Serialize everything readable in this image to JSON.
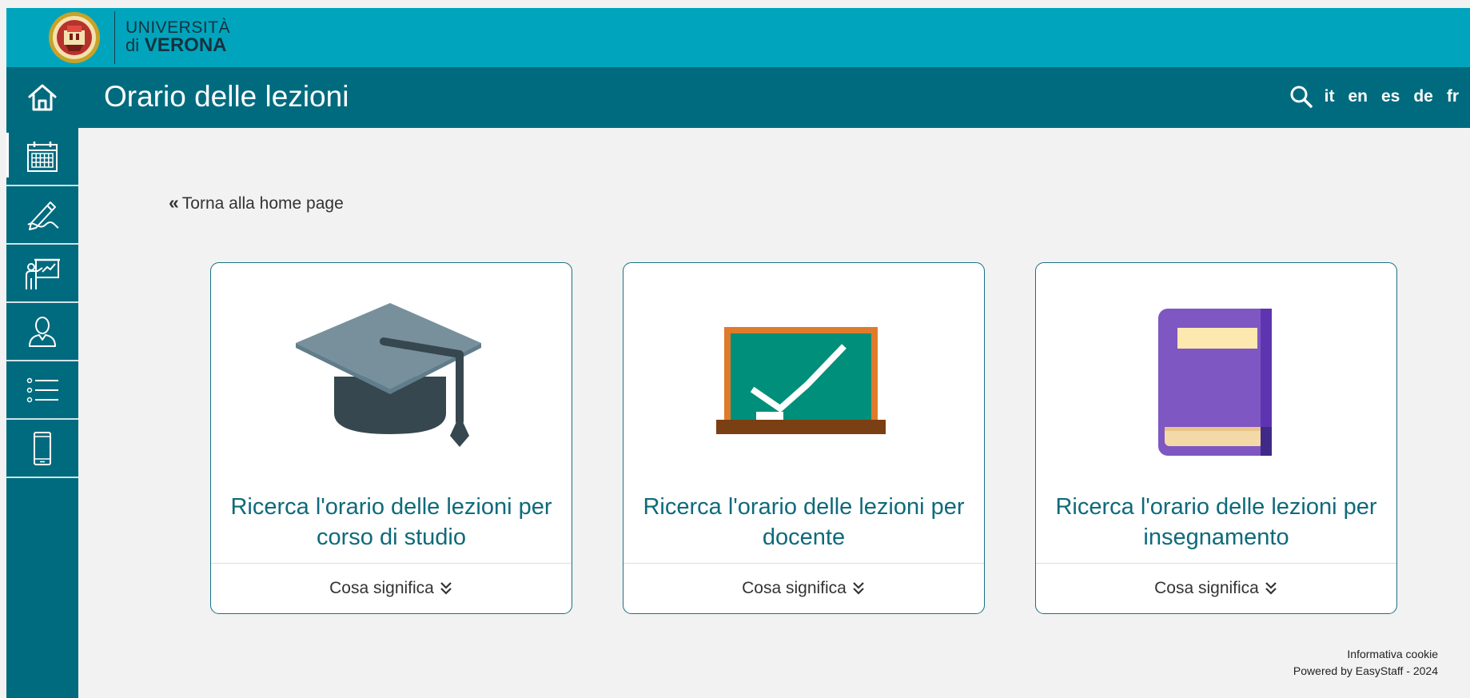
{
  "logo": {
    "line1": "UNIVERSITÀ",
    "line2_prefix": "di",
    "line2_name": "VERONA"
  },
  "header": {
    "title": "Orario delle lezioni",
    "languages": [
      "it",
      "en",
      "es",
      "de",
      "fr"
    ]
  },
  "sidebar": {
    "items": [
      {
        "icon": "calendar-icon"
      },
      {
        "icon": "pen-signature-icon"
      },
      {
        "icon": "teacher-board-icon"
      },
      {
        "icon": "person-icon"
      },
      {
        "icon": "list-icon"
      },
      {
        "icon": "mobile-icon"
      }
    ]
  },
  "main": {
    "back_link": "Torna alla home page",
    "cards": [
      {
        "title": "Ricerca l'orario delle lezioni per corso di studio",
        "footer": "Cosa significa"
      },
      {
        "title": "Ricerca l'orario delle lezioni per docente",
        "footer": "Cosa significa"
      },
      {
        "title": "Ricerca l'orario delle lezioni per insegnamento",
        "footer": "Cosa significa"
      }
    ]
  },
  "footer": {
    "cookie": "Informativa cookie",
    "powered": "Powered by EasyStaff - 2024"
  },
  "colors": {
    "topbar": "#00a5bd",
    "header": "#006b7f",
    "card_title": "#0e6a7a",
    "background": "#f2f2f2"
  }
}
